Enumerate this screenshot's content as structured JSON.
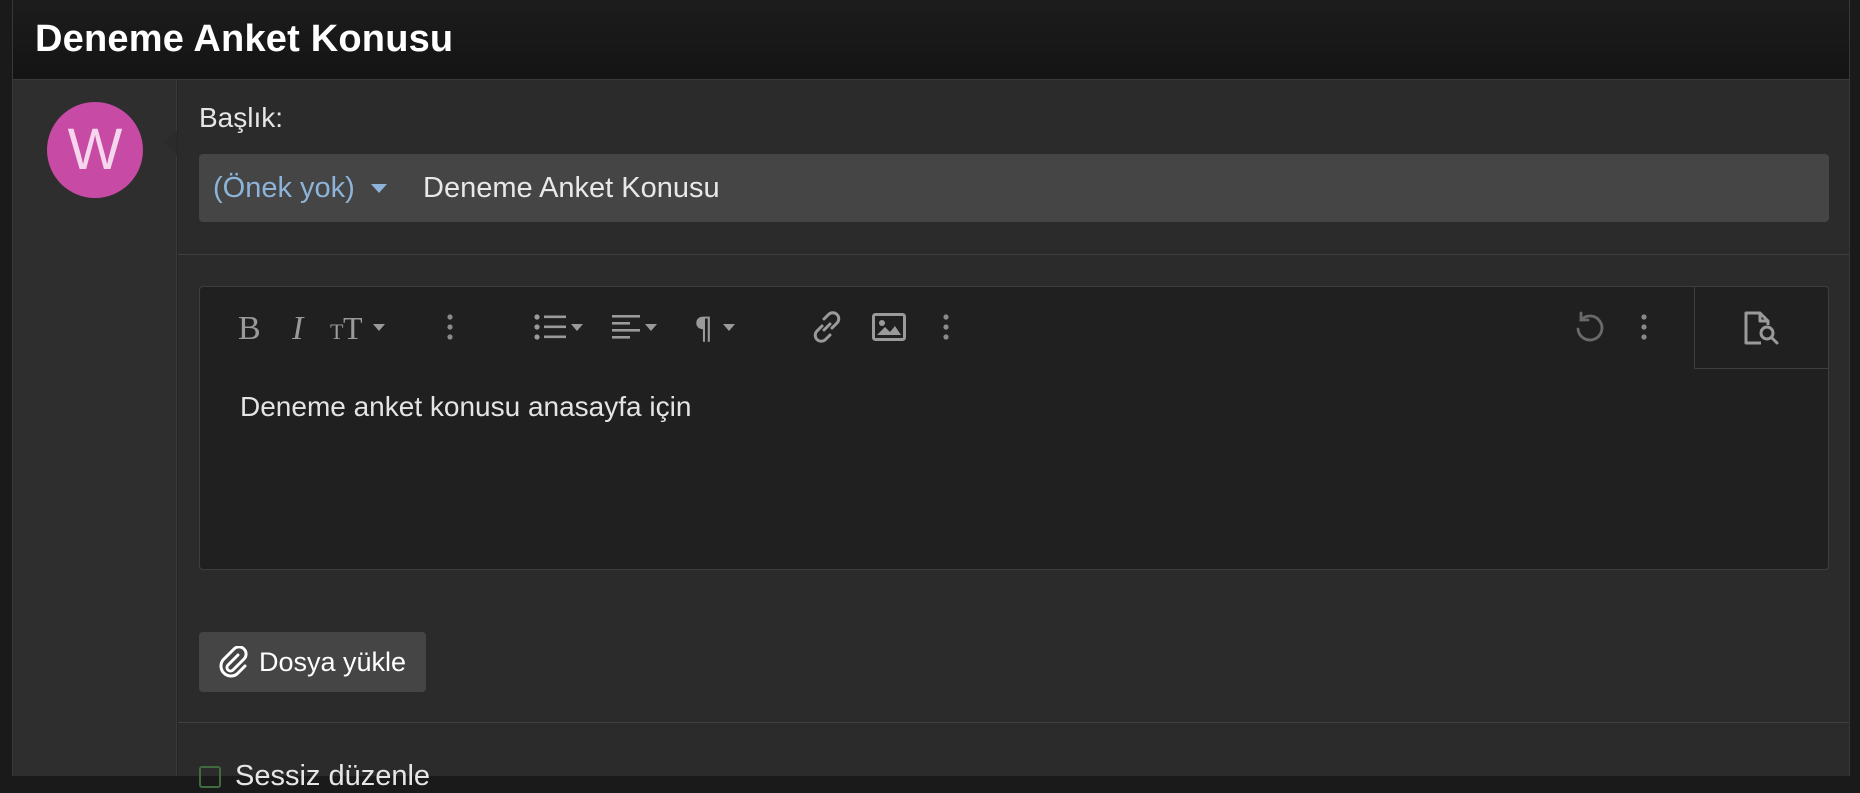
{
  "page": {
    "title": "Deneme Anket Konusu"
  },
  "user": {
    "avatar_letter": "W",
    "avatar_color": "#c74aa5"
  },
  "form": {
    "title_label": "Başlık:",
    "prefix_value": "(Önek yok)",
    "title_value": "Deneme Anket Konusu"
  },
  "editor": {
    "toolbar": [
      {
        "name": "bold-icon",
        "label": "B"
      },
      {
        "name": "italic-icon",
        "label": "I"
      },
      {
        "name": "text-size-icon",
        "label": "TT"
      },
      {
        "name": "more-text-icon",
        "label": "⋮"
      },
      {
        "name": "list-icon",
        "label": "list"
      },
      {
        "name": "align-icon",
        "label": "align"
      },
      {
        "name": "paragraph-icon",
        "label": "¶"
      },
      {
        "name": "link-icon",
        "label": "link"
      },
      {
        "name": "image-icon",
        "label": "image"
      },
      {
        "name": "more-insert-icon",
        "label": "⋮"
      },
      {
        "name": "undo-icon",
        "label": "undo"
      },
      {
        "name": "more-options-icon",
        "label": "⋮"
      },
      {
        "name": "preview-icon",
        "label": "preview"
      }
    ],
    "content": "Deneme anket konusu anasayfa için"
  },
  "upload": {
    "label": "Dosya yükle"
  },
  "options": {
    "silent_edit_label": "Sessiz düzenle"
  }
}
